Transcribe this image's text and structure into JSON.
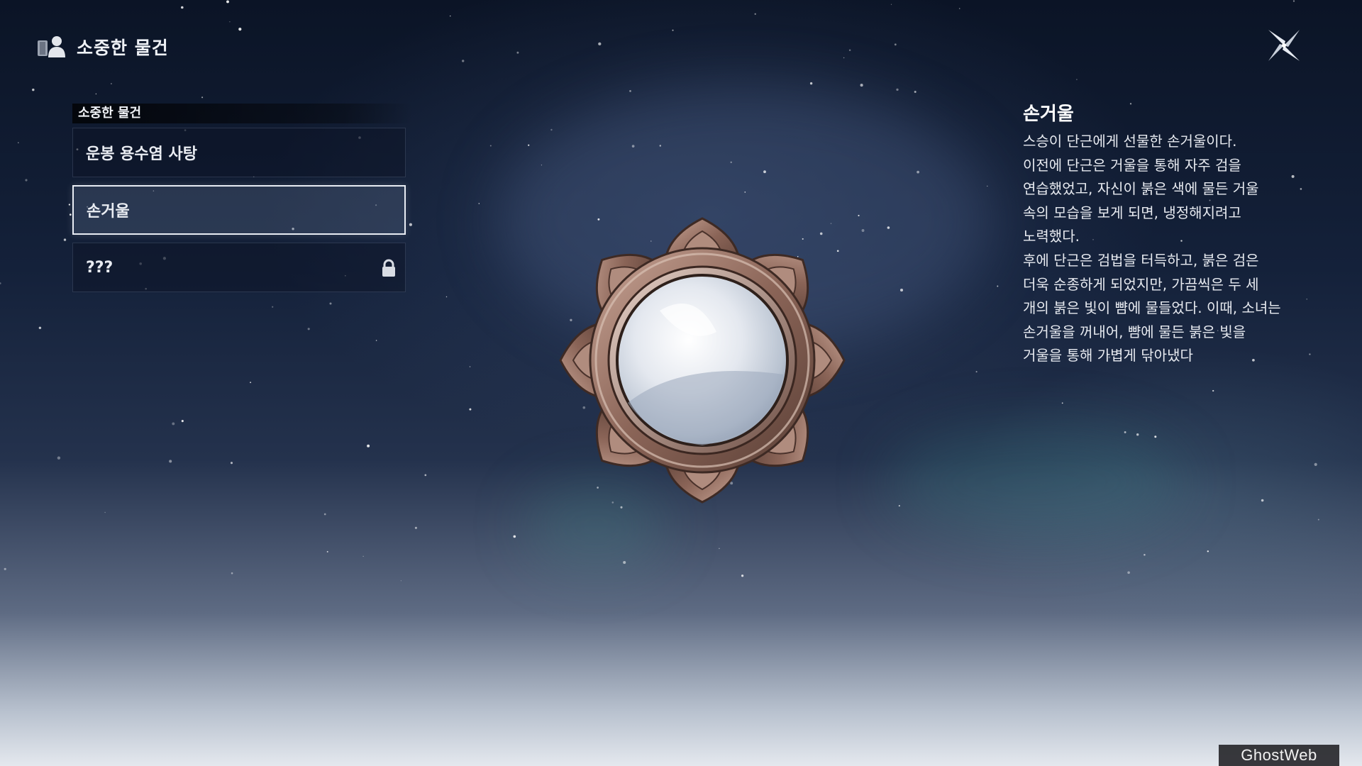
{
  "header": {
    "title": "소중한 물건",
    "icon": "book-person-icon"
  },
  "close_button": {
    "icon": "close-x-icon"
  },
  "list": {
    "header": "소중한 물건",
    "items": [
      {
        "label": "운봉 용수염 사탕",
        "selected": false,
        "locked": false
      },
      {
        "label": "손거울",
        "selected": true,
        "locked": false
      },
      {
        "label": "???",
        "selected": false,
        "locked": true,
        "icon": "lock-icon"
      }
    ]
  },
  "detail": {
    "title": "손거울",
    "description": "스승이 단근에게 선물한 손거울이다.\n이전에 단근은 거울을 통해 자주 검을\n연습했었고, 자신이 붉은 색에 물든 거울\n속의 모습을 보게 되면, 냉정해지려고\n노력했다.\n후에 단근은 검법을 터득하고, 붉은 검은\n더욱 순종하게 되었지만, 가끔씩은 두 세\n개의 붉은 빛이 뺨에 물들었다. 이때, 소녀는\n손거울을 꺼내어, 뺨에 물든 붉은 빛을\n거울을 통해 가볍게 닦아냈다"
  },
  "watermark": "GhostWeb"
}
